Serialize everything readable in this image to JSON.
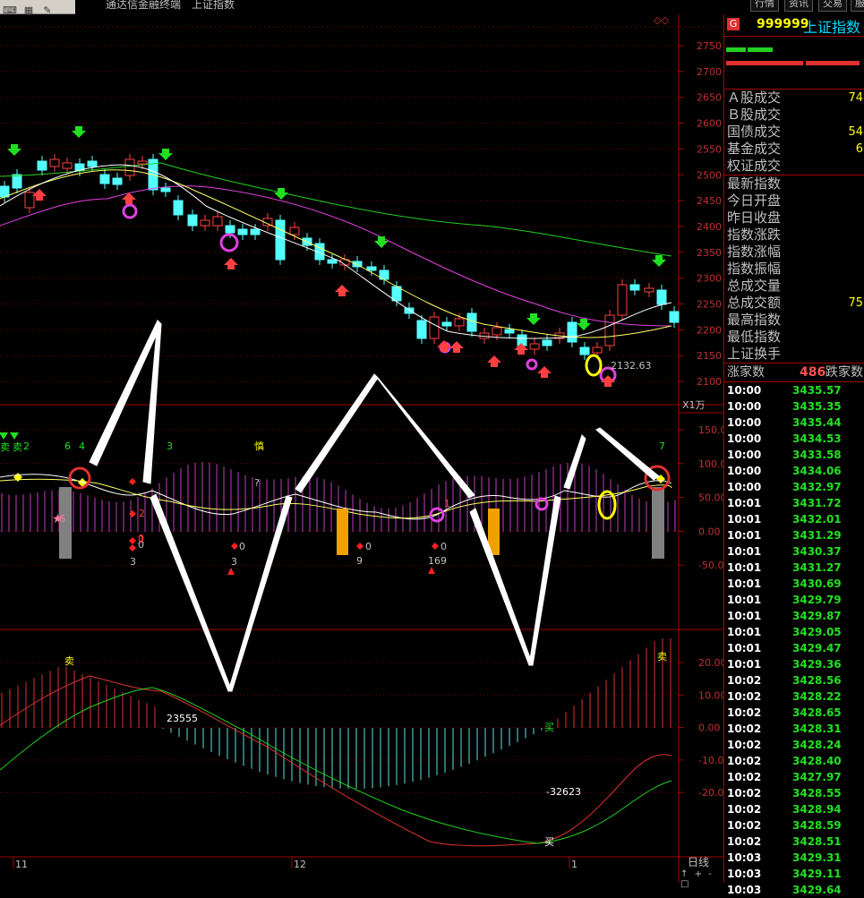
{
  "toolbar": {
    "icons": [
      "keyboard-icon",
      "grid-icon",
      "settings-icon"
    ],
    "app_title": "通达信金融终端",
    "index_title": "上证指数",
    "buttons": [
      "行情",
      "资讯",
      "交易",
      "服"
    ]
  },
  "header": {
    "badge": "G",
    "code": "999999",
    "name": "上证指数"
  },
  "stats": [
    {
      "label": "Ａ股成交",
      "value": "74"
    },
    {
      "label": "Ｂ股成交",
      "value": ""
    },
    {
      "label": "国债成交",
      "value": "54"
    },
    {
      "label": "基金成交",
      "value": "6"
    },
    {
      "label": "权证成交",
      "value": ""
    }
  ],
  "indices": [
    {
      "label": "最新指数",
      "value": ""
    },
    {
      "label": "今日开盘",
      "value": ""
    },
    {
      "label": "昨日收盘",
      "value": ""
    },
    {
      "label": "指数涨跌",
      "value": ""
    },
    {
      "label": "指数涨幅",
      "value": ""
    },
    {
      "label": "指数振幅",
      "value": ""
    },
    {
      "label": "总成交量",
      "value": ""
    },
    {
      "label": "总成交额",
      "value": "75"
    },
    {
      "label": "最高指数",
      "value": ""
    },
    {
      "label": "最低指数",
      "value": ""
    },
    {
      "label": "上证换手",
      "value": ""
    }
  ],
  "breadth": {
    "up_label": "涨家数",
    "up_value": "486",
    "down_label": "跌家数"
  },
  "ticks": [
    [
      "10:00",
      "3435.57"
    ],
    [
      "10:00",
      "3435.35"
    ],
    [
      "10:00",
      "3435.44"
    ],
    [
      "10:00",
      "3434.53"
    ],
    [
      "10:00",
      "3433.58"
    ],
    [
      "10:00",
      "3434.06"
    ],
    [
      "10:00",
      "3432.97"
    ],
    [
      "10:01",
      "3431.72"
    ],
    [
      "10:01",
      "3432.01"
    ],
    [
      "10:01",
      "3431.29"
    ],
    [
      "10:01",
      "3430.37"
    ],
    [
      "10:01",
      "3431.27"
    ],
    [
      "10:01",
      "3430.69"
    ],
    [
      "10:01",
      "3429.79"
    ],
    [
      "10:01",
      "3429.87"
    ],
    [
      "10:01",
      "3429.05"
    ],
    [
      "10:01",
      "3429.47"
    ],
    [
      "10:01",
      "3429.36"
    ],
    [
      "10:02",
      "3428.56"
    ],
    [
      "10:02",
      "3428.22"
    ],
    [
      "10:02",
      "3428.65"
    ],
    [
      "10:02",
      "3428.31"
    ],
    [
      "10:02",
      "3428.24"
    ],
    [
      "10:02",
      "3428.40"
    ],
    [
      "10:02",
      "3427.97"
    ],
    [
      "10:02",
      "3428.55"
    ],
    [
      "10:02",
      "3428.94"
    ],
    [
      "10:02",
      "3428.59"
    ],
    [
      "10:02",
      "3428.51"
    ],
    [
      "10:03",
      "3429.31"
    ],
    [
      "10:03",
      "3429.11"
    ],
    [
      "10:03",
      "3429.64"
    ]
  ],
  "chart_data": [
    {
      "type": "candlestick",
      "y_ticks": [
        "2750",
        "2700",
        "2650",
        "2600",
        "2550",
        "2500",
        "2450",
        "2400",
        "2350",
        "2300",
        "2250",
        "2200",
        "2150",
        "2100"
      ],
      "annotation": "2132.63"
    },
    {
      "type": "bar",
      "unit": "X1万",
      "y_ticks": [
        "150.0",
        "100.0",
        "50.00",
        "0.00",
        "-50.00"
      ],
      "labels": [
        "卖",
        "卖",
        "2",
        "6",
        "4",
        "3",
        "慎",
        "?",
        "3",
        "3",
        "9",
        "1",
        "169",
        "0",
        "0",
        "0",
        "0",
        "0",
        "2",
        "1",
        "6",
        "7"
      ]
    },
    {
      "type": "bar",
      "y_ticks": [
        "20.00",
        "10.00",
        "0.00",
        "-10.00",
        "-20.00"
      ],
      "labels": [
        "卖",
        "23555",
        "买",
        "-32623",
        "买",
        "卖"
      ]
    }
  ],
  "x_axis": {
    "labels": [
      "11",
      "12",
      "1"
    ],
    "period": "日线"
  },
  "bottom_buttons": [
    "↑",
    "+",
    "-",
    "□"
  ]
}
